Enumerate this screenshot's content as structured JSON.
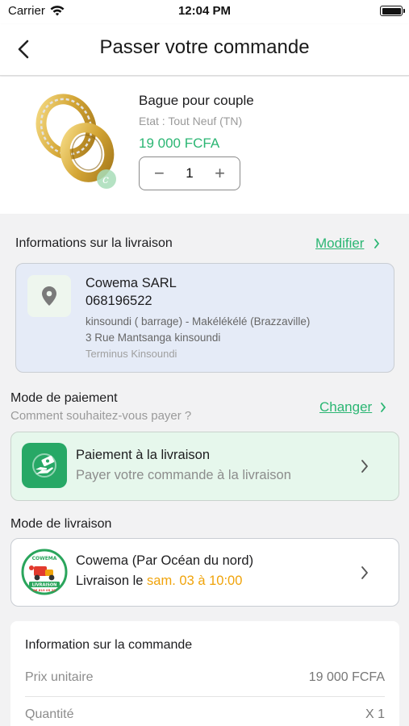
{
  "status_bar": {
    "carrier": "Carrier",
    "time": "12:04 PM"
  },
  "header": {
    "title": "Passer votre commande"
  },
  "product": {
    "name": "Bague pour couple",
    "state": "Etat : Tout Neuf (TN)",
    "price": "19 000 FCFA",
    "quantity": "1",
    "decrement": "−",
    "increment": "+"
  },
  "delivery_info": {
    "title": "Informations sur la livraison",
    "edit_label": "Modifier",
    "name": "Cowema SARL",
    "phone": "068196522",
    "line1": "kinsoundi ( barrage)  - Makélékélé (Brazzaville)",
    "line2": "3 Rue Mantsanga kinsoundi",
    "line3": "Terminus Kinsoundi"
  },
  "payment": {
    "title": "Mode de paiement",
    "question": "Comment souhaitez-vous payer ?",
    "change_label": "Changer",
    "method_title": "Paiement à la livraison",
    "method_subtitle": "Payer votre commande à la livraison"
  },
  "delivery_mode": {
    "title": "Mode de livraison",
    "carrier_name": "Cowema (Par Océan du nord)",
    "prefix": "Livraison le ",
    "date": "sam. 03 à 10:00",
    "logo_text_top": "COWEMA",
    "logo_text_bottom": "LIVRAISON",
    "logo_phone": "06 619 05 22"
  },
  "order_info": {
    "title": "Information sur la commande",
    "rows": [
      {
        "label": "Prix unitaire",
        "value": "19 000 FCFA"
      },
      {
        "label": "Quantité",
        "value": "X 1"
      }
    ]
  },
  "colors": {
    "accent": "#2bb673",
    "date": "#f0a30a",
    "address_bg": "#e5ebf7",
    "payment_bg": "#e6f7ec"
  }
}
